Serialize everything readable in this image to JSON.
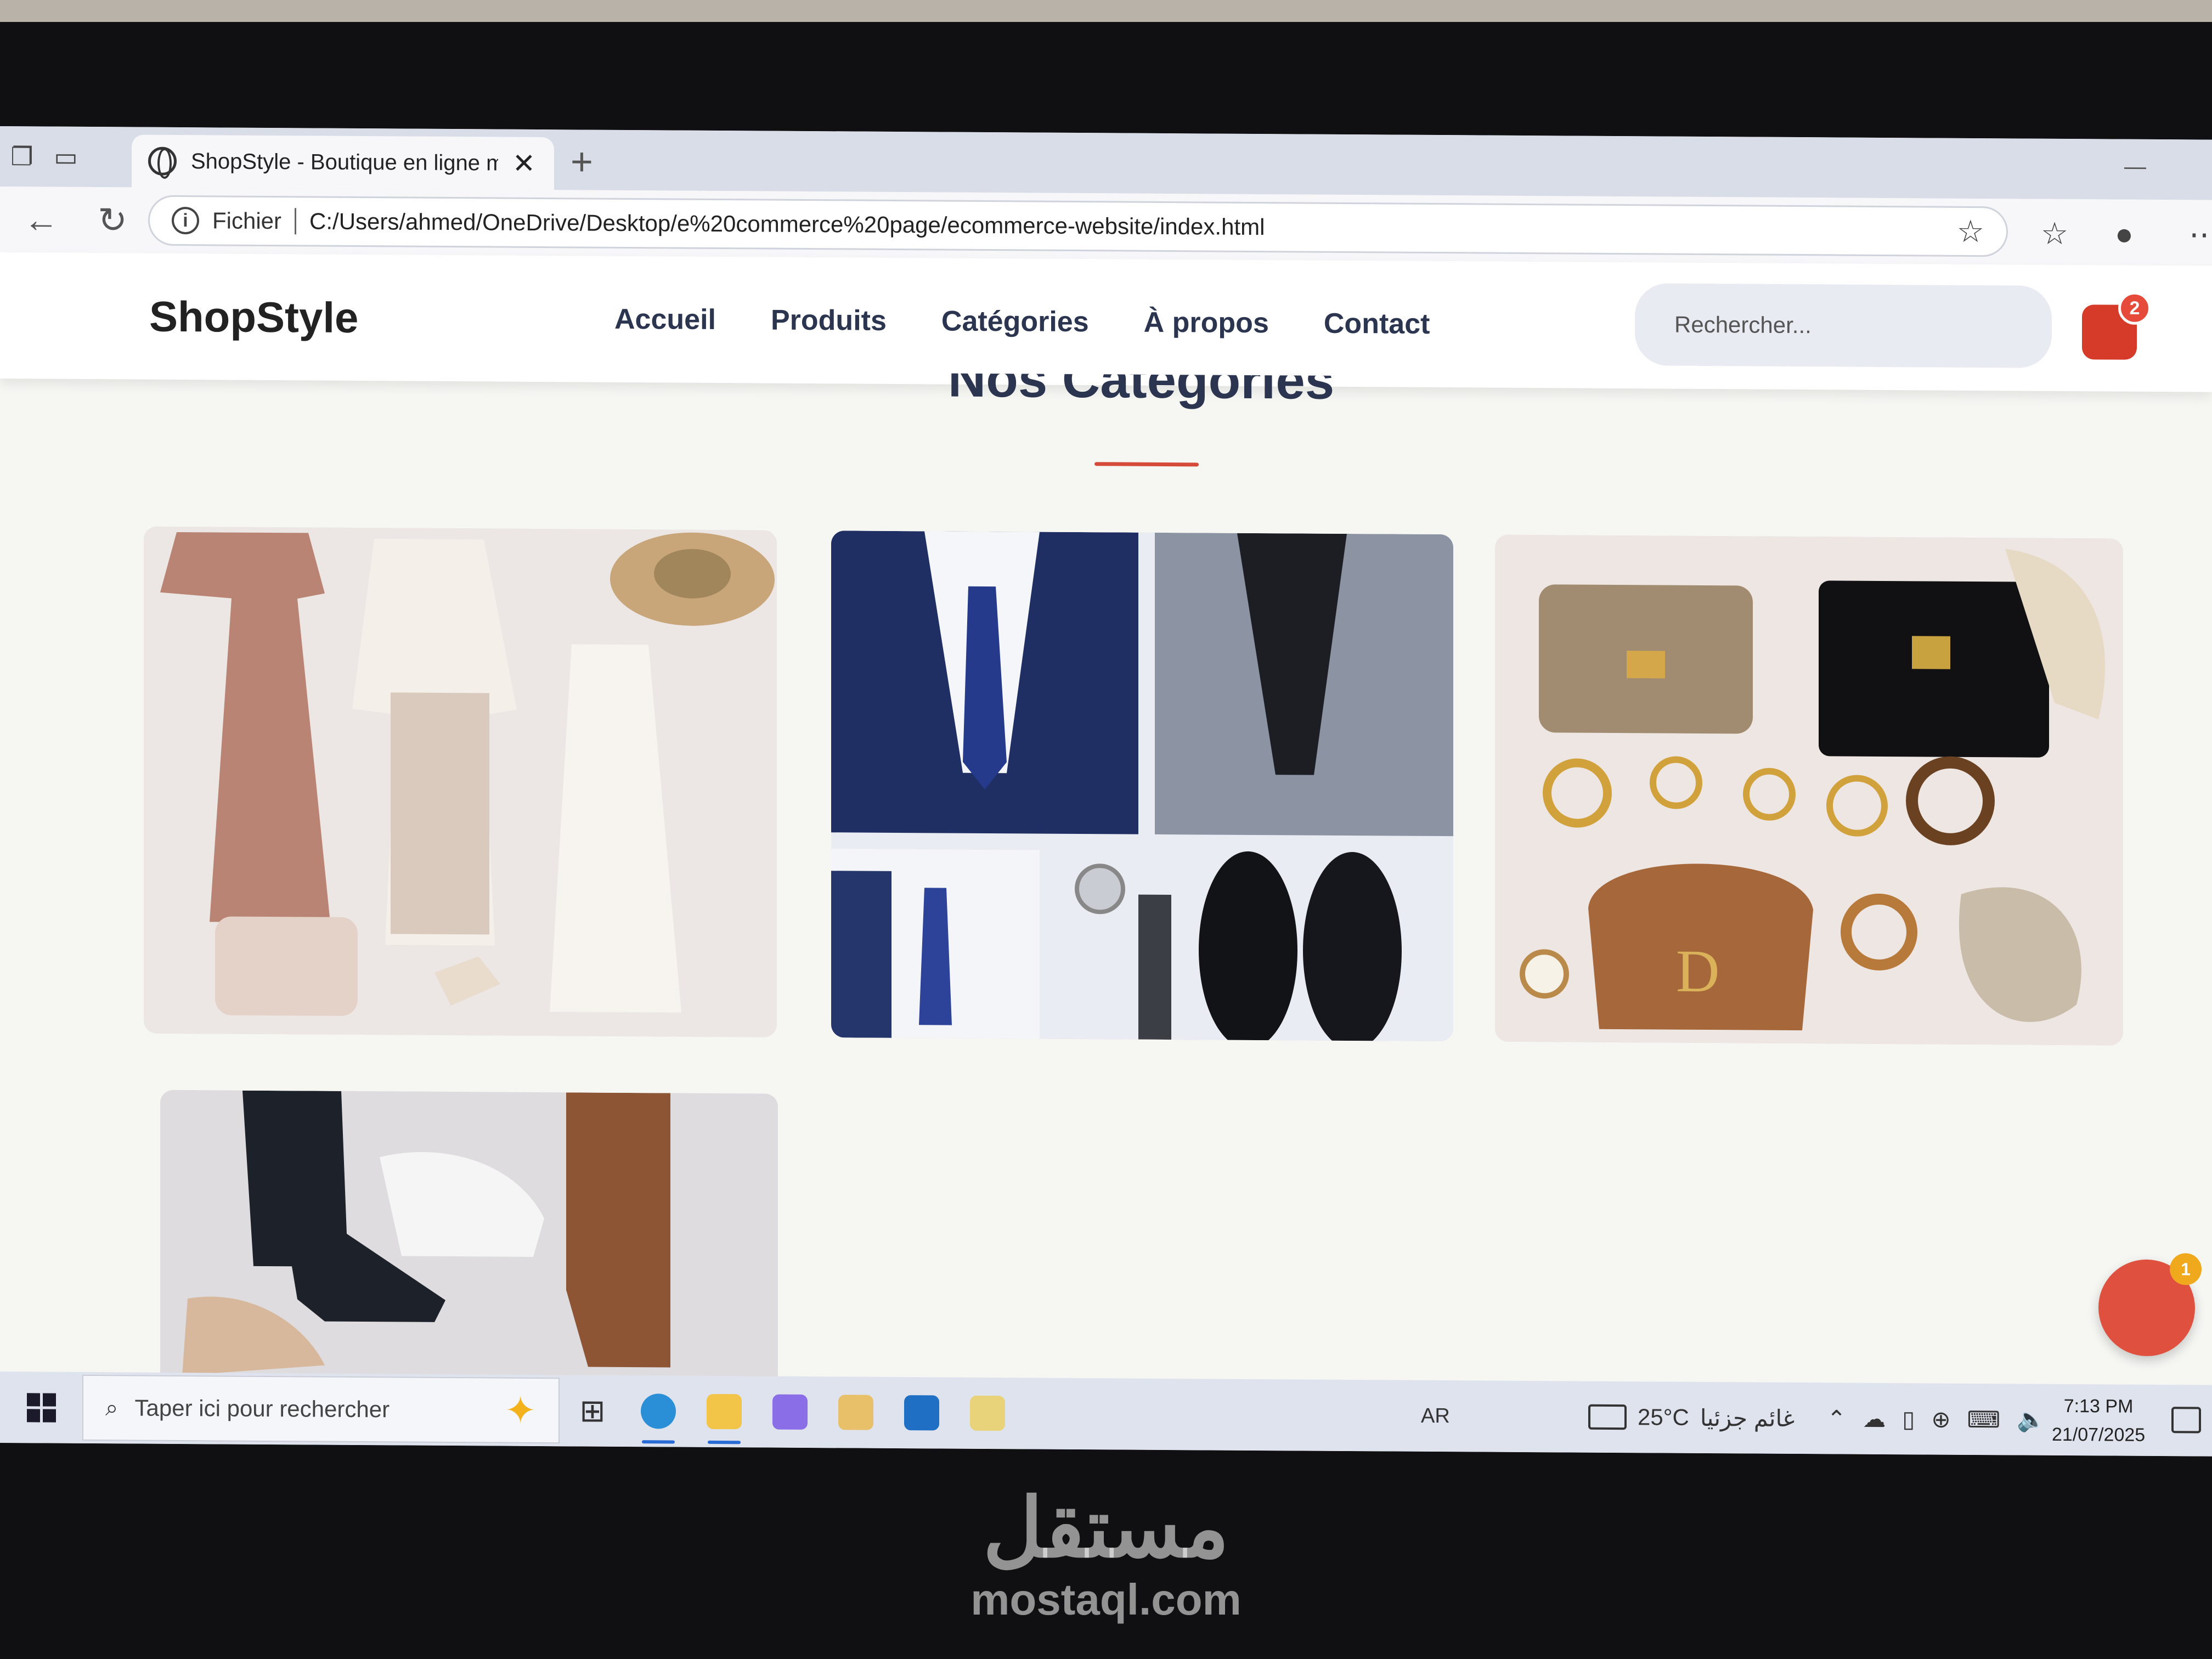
{
  "browser": {
    "tab_title": "ShopStyle - Boutique en ligne mo",
    "tab_close": "✕",
    "new_tab": "+",
    "address_prefix": "Fichier",
    "url": "C:/Users/ahmed/OneDrive/Desktop/e%20commerce%20page/ecommerce-website/index.html"
  },
  "site": {
    "logo": "ShopStyle",
    "nav": [
      "Accueil",
      "Produits",
      "Catégories",
      "À propos",
      "Contact"
    ],
    "search_placeholder": "Rechercher...",
    "cart_count": "2",
    "section_title": "Nos Catégories",
    "chat_badge": "1"
  },
  "taskbar": {
    "search_placeholder": "Taper ici pour rechercher",
    "language": "AR",
    "temperature": "25°C",
    "weather_text": "غائم جزئيا",
    "time": "7:13 PM",
    "date": "21/07/2025"
  },
  "watermark": {
    "arabic": "مستقل",
    "latin": "mostaql.com"
  },
  "colors": {
    "accent": "#d63b2a",
    "nav_text": "#2b3550",
    "badge_orange": "#f0a81c"
  }
}
